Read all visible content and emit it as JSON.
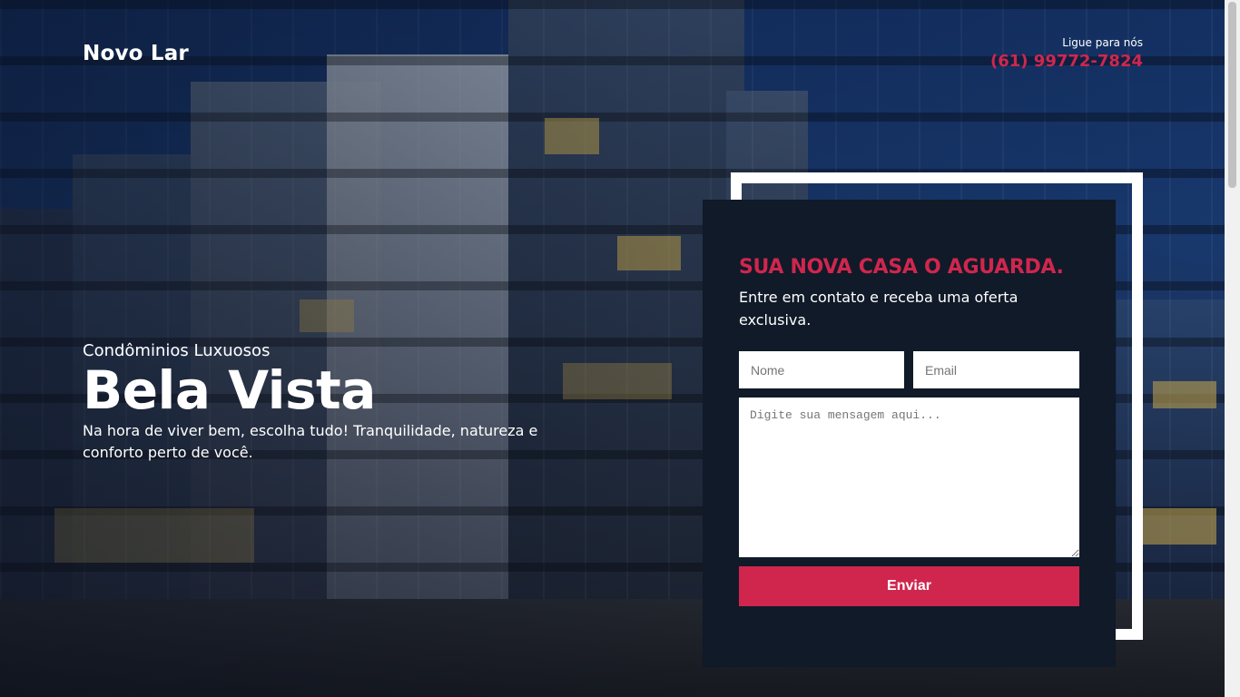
{
  "header": {
    "logo": "Novo Lar",
    "call_label": "Ligue para nós",
    "phone": "(61) 99772-7824"
  },
  "hero": {
    "kicker": "Condôminios Luxuosos",
    "title": "Bela Vista",
    "description": "Na hora de viver bem, escolha tudo! Tranquilidade, natureza e conforto perto de você."
  },
  "form": {
    "title": "SUA NOVA CASA O AGUARDA.",
    "subtitle": "Entre em contato e receba uma oferta exclusiva.",
    "name_placeholder": "Nome",
    "email_placeholder": "Email",
    "message_placeholder": "Digite sua mensagem aqui...",
    "submit_label": "Enviar"
  },
  "colors": {
    "accent": "#d0264e",
    "card_bg": "#101a28",
    "text": "#ffffff"
  }
}
